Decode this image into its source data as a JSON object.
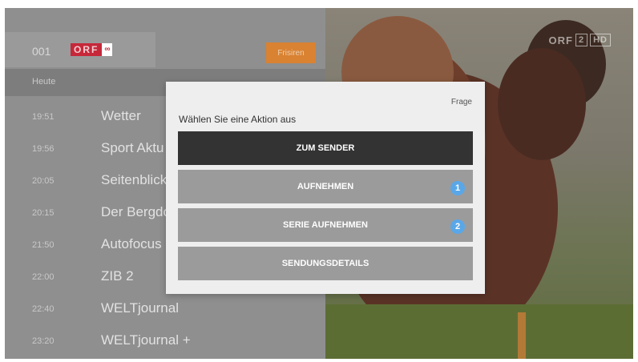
{
  "header": {
    "channel_number": "001",
    "channel_logo": {
      "text": "ORF",
      "suffix": "∞"
    },
    "record_button_label": "Frisiren"
  },
  "video": {
    "logo_text": "ORF",
    "logo_num": "2",
    "logo_hd": "HD"
  },
  "epg": {
    "day_label": "Heute",
    "programs": [
      {
        "time": "19:51",
        "title": "Wetter"
      },
      {
        "time": "19:56",
        "title": "Sport Aktu"
      },
      {
        "time": "20:05",
        "title": "Seitenblick"
      },
      {
        "time": "20:15",
        "title": "Der Bergdo"
      },
      {
        "time": "21:50",
        "title": "Autofocus"
      },
      {
        "time": "22:00",
        "title": "ZIB 2"
      },
      {
        "time": "22:40",
        "title": "WELTjournal"
      },
      {
        "time": "23:20",
        "title": "WELTjournal +"
      }
    ]
  },
  "dialog": {
    "type_label": "Frage",
    "prompt": "Wählen Sie eine Aktion aus",
    "actions": [
      {
        "label": "ZUM SENDER",
        "badge": ""
      },
      {
        "label": "AUFNEHMEN",
        "badge": "1"
      },
      {
        "label": "SERIE AUFNEHMEN",
        "badge": "2"
      },
      {
        "label": "SENDUNGSDETAILS",
        "badge": ""
      }
    ]
  },
  "colors": {
    "orf_red": "#c6283a",
    "record_orange": "#d98232",
    "primary_button": "#333333",
    "secondary_button": "#9b9b9b",
    "badge_blue": "#5aa7e8"
  }
}
